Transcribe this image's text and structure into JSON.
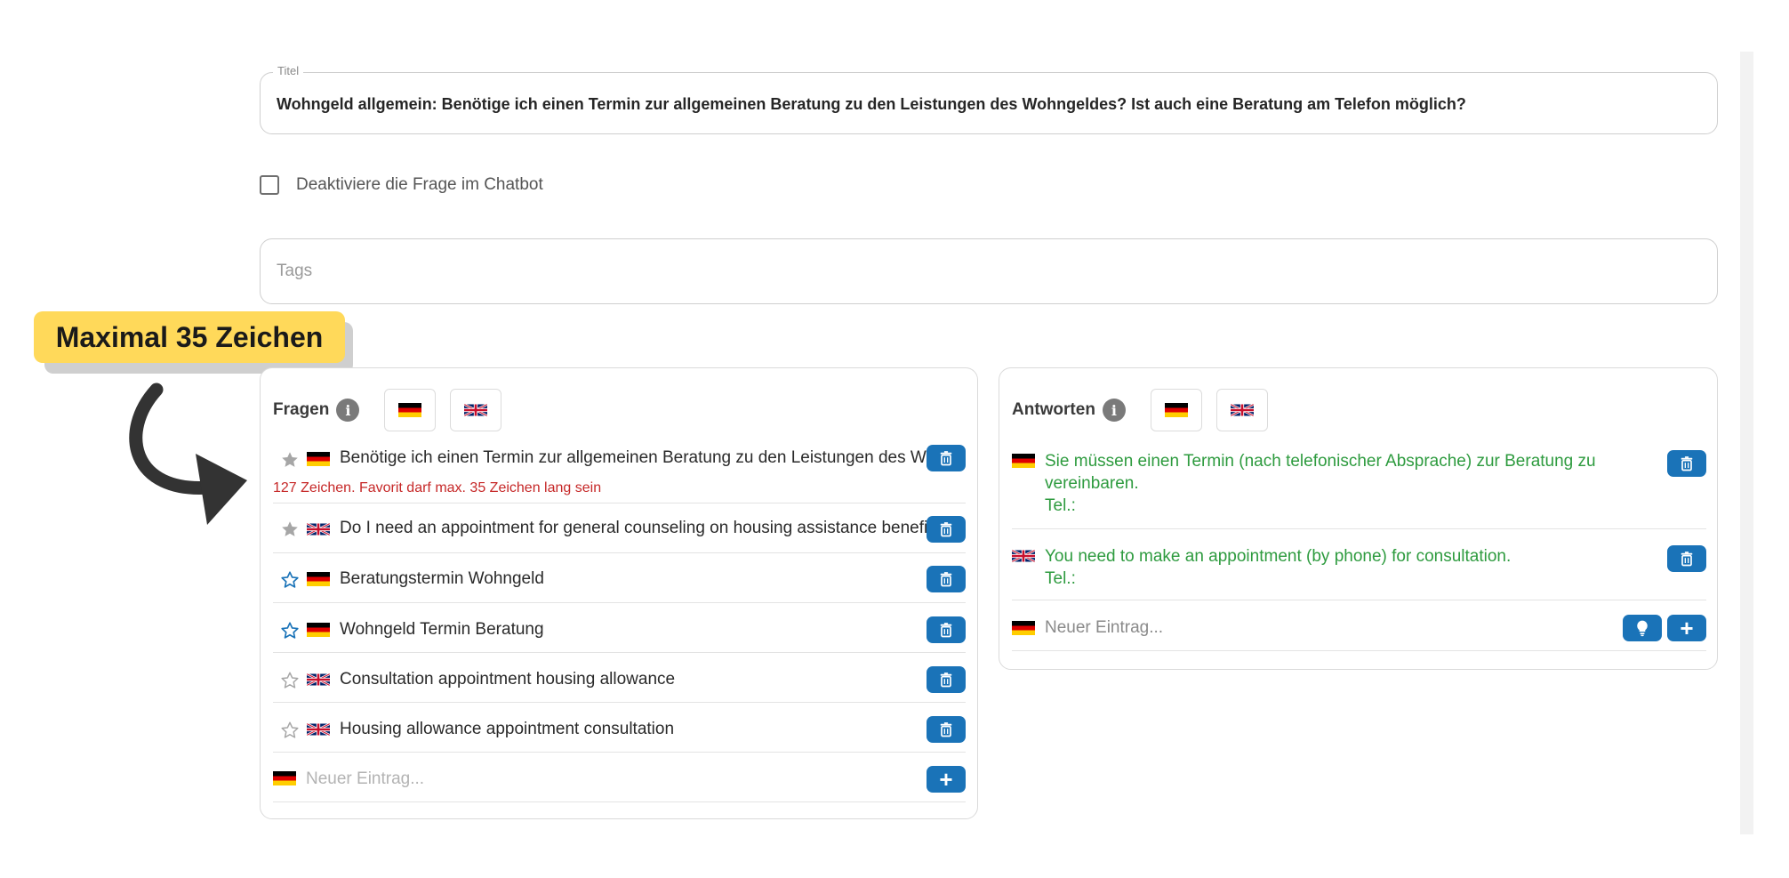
{
  "title_field": {
    "legend": "Titel",
    "value": "Wohngeld allgemein: Benötige ich einen Termin zur allgemeinen Beratung zu den Leistungen des Wohngeldes? Ist auch eine Beratung am Telefon möglich?"
  },
  "deactivate_checkbox": {
    "label": "Deaktiviere die Frage im Chatbot",
    "checked": false
  },
  "tags_field": {
    "placeholder": "Tags"
  },
  "annotation": {
    "label": "Maximal 35 Zeichen",
    "color": "#ffd95a"
  },
  "questions_panel": {
    "title": "Fragen",
    "info_icon": "info-icon",
    "language_buttons": [
      "de-flag-icon",
      "uk-flag-icon"
    ],
    "items": [
      {
        "text": "Benötige ich einen Termin zur allgemeinen Beratung zu den Leistungen des Wohngeldes? Ist auch eine Beratung am Telefon möglich?",
        "language": "de",
        "star": "filled-gray",
        "error": "127 Zeichen. Favorit darf max. 35 Zeichen lang sein"
      },
      {
        "text": "Do I need an appointment for general counseling on housing assistance benefits?",
        "language": "en",
        "star": "filled-gray"
      },
      {
        "text": "Beratungstermin Wohngeld",
        "language": "de",
        "star": "outline-blue"
      },
      {
        "text": "Wohngeld Termin Beratung",
        "language": "de",
        "star": "outline-blue"
      },
      {
        "text": "Consultation appointment housing allowance",
        "language": "en",
        "star": "outline-gray"
      },
      {
        "text": "Housing allowance appointment consultation",
        "language": "en",
        "star": "outline-gray"
      }
    ],
    "new_entry_placeholder": "Neuer Eintrag..."
  },
  "answers_panel": {
    "title": "Antworten",
    "info_icon": "info-icon",
    "language_buttons": [
      "de-flag-icon",
      "uk-flag-icon"
    ],
    "items": [
      {
        "language": "de",
        "line1": "Sie müssen einen Termin (nach telefonischer Absprache) zur Beratung zu",
        "line2": "vereinbaren.",
        "line3": "Tel.:"
      },
      {
        "language": "en",
        "line1": "You need to make an appointment (by phone) for consultation.",
        "line2": "Tel.:"
      }
    ],
    "new_entry_placeholder": "Neuer Eintrag..."
  },
  "colors": {
    "accent_button": "#1a73b8",
    "error": "#c62828",
    "answer_text": "#2e9b3f",
    "star_blue": "#1a73b8"
  }
}
